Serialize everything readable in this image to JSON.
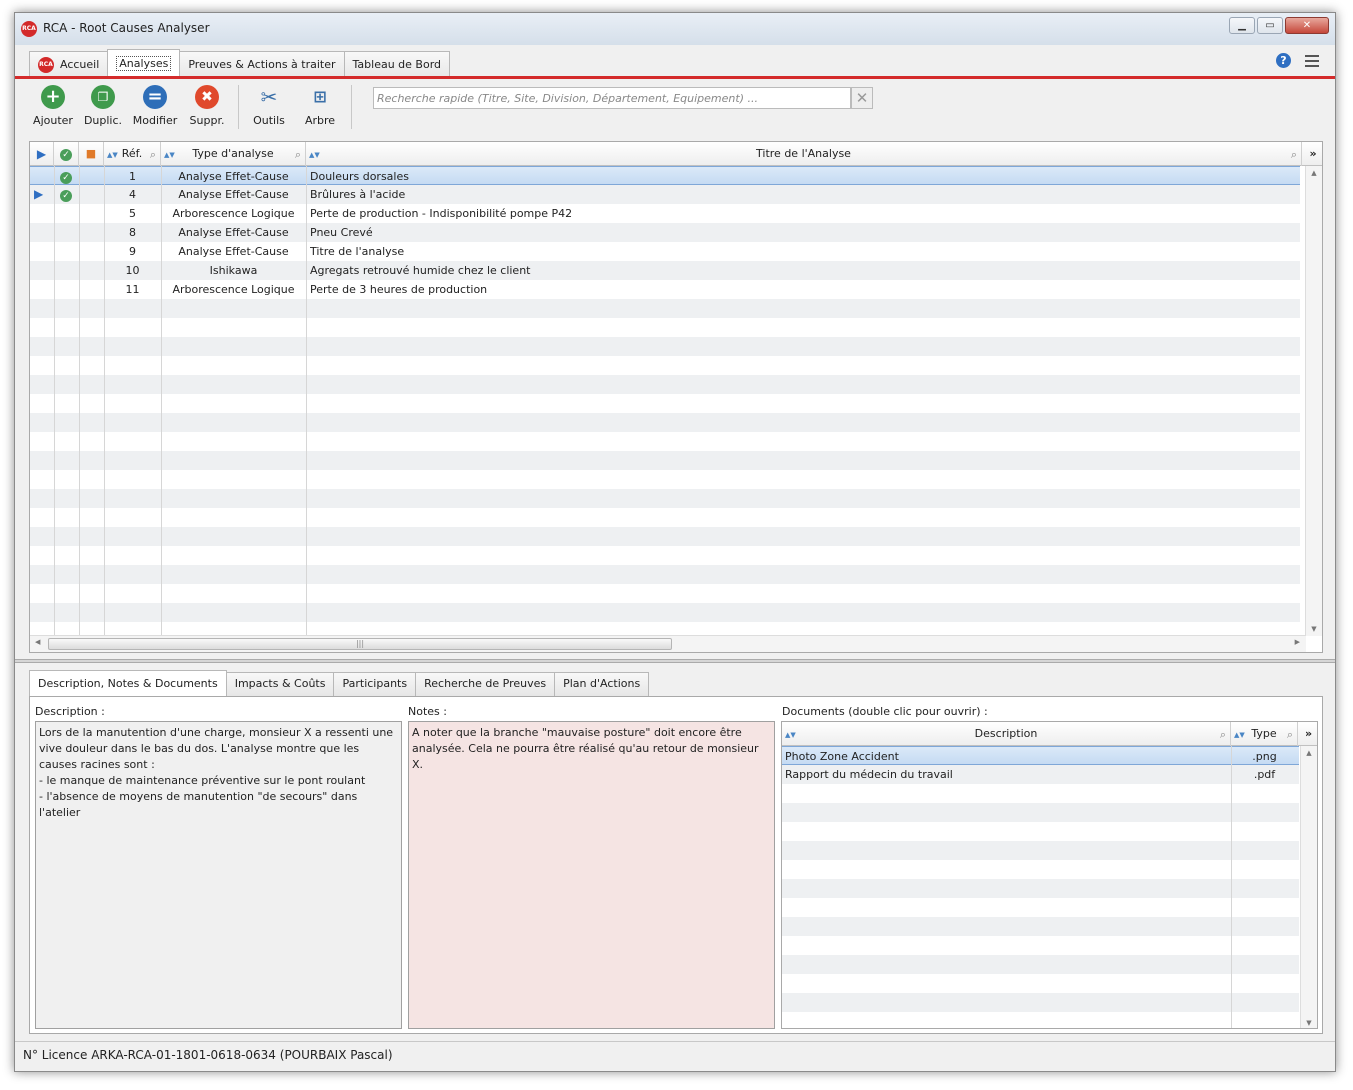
{
  "window": {
    "title": "RCA - Root Causes Analyser",
    "logo_text": "RCA"
  },
  "tabs": [
    {
      "label": "Accueil"
    },
    {
      "label": "Analyses"
    },
    {
      "label": "Preuves & Actions à traiter"
    },
    {
      "label": "Tableau de Bord"
    }
  ],
  "toolbar": {
    "add_label": "Ajouter",
    "dup_label": "Duplic.",
    "edit_label": "Modifier",
    "del_label": "Suppr.",
    "tools_label": "Outils",
    "tree_label": "Arbre",
    "search_placeholder": "Recherche rapide (Titre, Site, Division, Département, Equipement) ..."
  },
  "grid": {
    "columns": {
      "ref": "Réf.",
      "type": "Type d'analyse",
      "title": "Titre de l'Analyse"
    },
    "rows": [
      {
        "ref": "1",
        "type": "Analyse Effet-Cause",
        "title": "Douleurs dorsales",
        "checked": true,
        "current": false
      },
      {
        "ref": "4",
        "type": "Analyse Effet-Cause",
        "title": "Brûlures à l'acide",
        "checked": true,
        "current": true
      },
      {
        "ref": "5",
        "type": "Arborescence Logique",
        "title": "Perte de production - Indisponibilité pompe P42",
        "checked": false,
        "current": false
      },
      {
        "ref": "8",
        "type": "Analyse Effet-Cause",
        "title": "Pneu Crevé",
        "checked": false,
        "current": false
      },
      {
        "ref": "9",
        "type": "Analyse Effet-Cause",
        "title": "Titre de l'analyse",
        "checked": false,
        "current": false
      },
      {
        "ref": "10",
        "type": "Ishikawa",
        "title": "Agregats retrouvé humide chez le client",
        "checked": false,
        "current": false
      },
      {
        "ref": "11",
        "type": "Arborescence Logique",
        "title": "Perte de 3 heures de production",
        "checked": false,
        "current": false
      }
    ]
  },
  "bottom_tabs": [
    {
      "label": "Description, Notes & Documents"
    },
    {
      "label": "Impacts & Coûts"
    },
    {
      "label": "Participants"
    },
    {
      "label": "Recherche de Preuves"
    },
    {
      "label": "Plan d'Actions"
    }
  ],
  "details": {
    "description_label": "Description :",
    "description_text": "Lors de la manutention d'une charge, monsieur X a ressenti une vive douleur dans le bas du dos. L'analyse montre que les causes racines sont :\n- le manque de maintenance préventive sur le pont roulant\n- l'absence de moyens de manutention \"de secours\" dans l'atelier",
    "notes_label": "Notes :",
    "notes_text": "A noter que la branche \"mauvaise posture\" doit encore être analysée. Cela ne pourra être réalisé qu'au retour de monsieur X.",
    "documents_label": "Documents (double clic pour ouvrir) :",
    "doc_columns": {
      "description": "Description",
      "type": "Type"
    },
    "documents": [
      {
        "description": "Photo Zone Accident",
        "type": ".png"
      },
      {
        "description": "Rapport du médecin du travail",
        "type": ".pdf"
      }
    ]
  },
  "status": {
    "license": "N° Licence ARKA-RCA-01-1801-0618-0634 (POURBAIX Pascal)"
  },
  "colors": {
    "accent_red": "#d42b2b",
    "selection": "#c5dbf3",
    "notes_bg": "#f5e4e3"
  }
}
